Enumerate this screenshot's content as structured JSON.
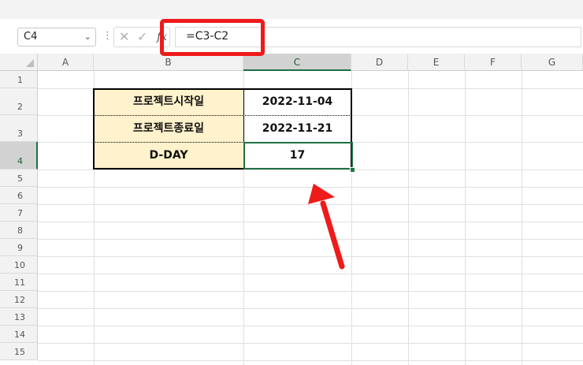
{
  "formula_bar": {
    "name_box": "C4",
    "name_box_dropdown_icon": "chevron-down-icon",
    "cancel_icon": "close-icon",
    "enter_icon": "checkmark-icon",
    "function_icon": "fx-icon",
    "formula": "=C3-C2"
  },
  "columns": [
    "A",
    "B",
    "C",
    "D",
    "E",
    "F",
    "G"
  ],
  "rows": [
    "1",
    "2",
    "3",
    "4",
    "5",
    "6",
    "7",
    "8",
    "9",
    "10",
    "11",
    "12",
    "13",
    "14",
    "15"
  ],
  "table": {
    "rows": [
      {
        "label": "프로젝트시작일",
        "value": "2022-11-04"
      },
      {
        "label": "프로젝트종료일",
        "value": "2022-11-21"
      },
      {
        "label": "D-DAY",
        "value": "17"
      }
    ]
  },
  "colors": {
    "highlight_red": "#ef1a1a",
    "label_fill": "#fff2cc",
    "selection_green": "#1f7145"
  }
}
